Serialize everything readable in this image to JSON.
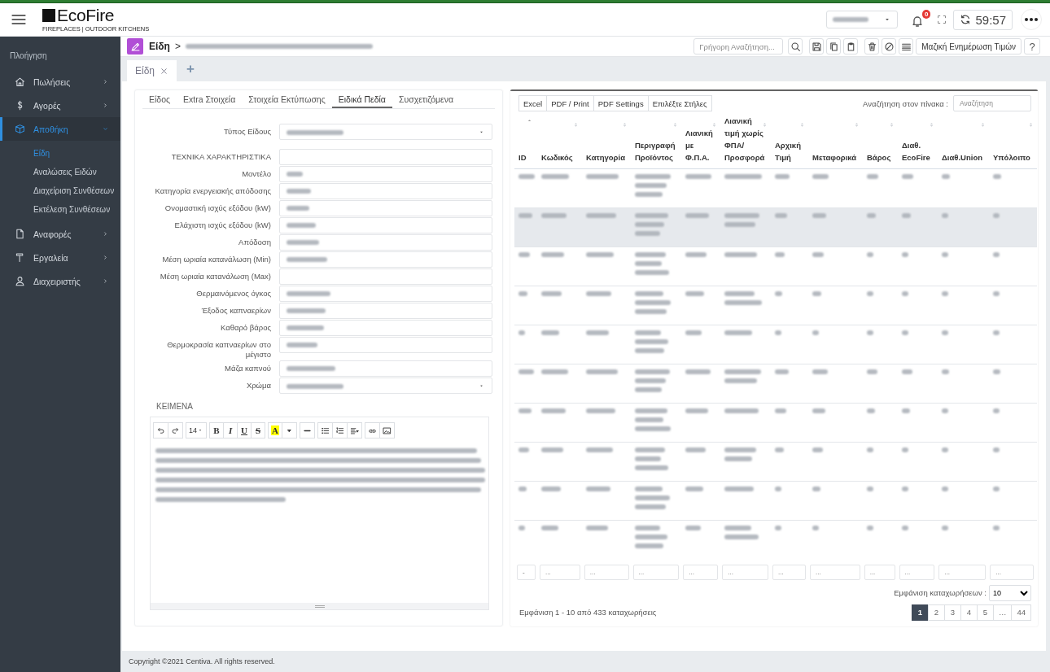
{
  "header": {
    "logo": {
      "name": "EcoFire",
      "tagline": "FIREPLACES | OUTDOOR KITCHENS"
    },
    "account_select": {
      "value_redacted": true
    },
    "notifications": {
      "count": "0"
    },
    "session_timer": "59:57"
  },
  "sidebar": {
    "heading": "Πλοήγηση",
    "items": [
      {
        "label": "Πωλήσεις",
        "selected": false,
        "expanded": false
      },
      {
        "label": "Αγορές",
        "selected": false,
        "expanded": false
      },
      {
        "label": "Αποθήκη",
        "selected": true,
        "expanded": true,
        "children": [
          {
            "label": "Είδη",
            "selected": true
          },
          {
            "label": "Αναλώσεις Ειδών",
            "selected": false
          },
          {
            "label": "Διαχείριση Συνθέσεων",
            "selected": false
          },
          {
            "label": "Εκτέλεση Συνθέσεων",
            "selected": false
          }
        ]
      },
      {
        "label": "Αναφορές",
        "selected": false,
        "expanded": false
      },
      {
        "label": "Εργαλεία",
        "selected": false,
        "expanded": false
      },
      {
        "label": "Διαχειριστής",
        "selected": false,
        "expanded": false
      }
    ]
  },
  "toolbar": {
    "breadcrumb": {
      "root": "Είδη",
      "separator": ">",
      "current_redacted": true
    },
    "quick_search": {
      "placeholder": "Γρήγορη Αναζήτηση..."
    },
    "mass_update": "Μαζική Ενημέρωση Τιμών",
    "help": "?"
  },
  "document_tabs": {
    "tabs": [
      {
        "label": "Είδη",
        "selected": true,
        "closable": true
      }
    ],
    "add": "+"
  },
  "form": {
    "tabs": [
      {
        "label": "Είδος",
        "selected": false
      },
      {
        "label": "Extra Στοιχεία",
        "selected": false
      },
      {
        "label": "Στοιχεία Εκτύπωσης",
        "selected": false
      },
      {
        "label": "Ειδικά Πεδία",
        "selected": true
      },
      {
        "label": "Συσχετιζόμενα",
        "selected": false
      }
    ],
    "fields": [
      {
        "label": "Τύπος Είδους",
        "kind": "select",
        "value_redacted": true
      },
      {
        "label": "ΤΕΧΝΙΚΑ ΧΑΡΑΚΤΗΡΙΣΤΙΚΑ",
        "kind": "text",
        "value_redacted": false
      },
      {
        "label": "Μοντέλο",
        "kind": "text",
        "value_redacted": true
      },
      {
        "label": "Κατηγορία ενεργειακής απόδοσης",
        "kind": "text",
        "value_redacted": true
      },
      {
        "label": "Ονομαστική ισχύς εξόδου (kW)",
        "kind": "text",
        "value_redacted": true
      },
      {
        "label": "Ελάχιστη ισχύς εξόδου (kW)",
        "kind": "text",
        "value_redacted": true
      },
      {
        "label": "Απόδοση",
        "kind": "text",
        "value_redacted": true
      },
      {
        "label": "Μέση ωριαία κατανάλωση (Min)",
        "kind": "text",
        "value_redacted": true
      },
      {
        "label": "Μέση ωριαία κατανάλωση (Max)",
        "kind": "text",
        "value_redacted": false
      },
      {
        "label": "Θερμαινόμενος όγκος",
        "kind": "text",
        "value_redacted": true
      },
      {
        "label": "Έξοδος καπναερίων",
        "kind": "text",
        "value_redacted": true
      },
      {
        "label": "Καθαρό βάρος",
        "kind": "text",
        "value_redacted": true
      },
      {
        "label": "Θερμοκρασία καπναερίων στο μέγιστο",
        "kind": "text",
        "value_redacted": true
      },
      {
        "label": "Μάζα καπνού",
        "kind": "text",
        "value_redacted": true
      },
      {
        "label": "Χρώμα",
        "kind": "select",
        "value_redacted": true
      }
    ],
    "section": "ΚΕΙΜΕΝΑ",
    "editor": {
      "toolbar": [
        [
          {
            "kind": "undo"
          },
          {
            "kind": "redo"
          }
        ],
        [
          {
            "kind": "font_size",
            "label": "14"
          }
        ],
        [
          {
            "kind": "bold",
            "label": "B"
          },
          {
            "kind": "italic",
            "label": "I"
          },
          {
            "kind": "underline",
            "label": "U"
          },
          {
            "kind": "strike",
            "label": "S"
          }
        ],
        [
          {
            "kind": "highlight",
            "label": "A"
          },
          {
            "kind": "color_menu"
          }
        ],
        [
          {
            "kind": "hr"
          }
        ],
        [
          {
            "kind": "ul"
          },
          {
            "kind": "ol"
          },
          {
            "kind": "align"
          }
        ],
        [
          {
            "kind": "link"
          },
          {
            "kind": "image"
          }
        ]
      ],
      "content_redacted": true
    }
  },
  "table": {
    "buttons": [
      "Excel",
      "PDF / Print",
      "PDF Settings",
      "Επιλέξτε Στήλες"
    ],
    "search_label": "Αναζήτηση στον πίνακα :",
    "search_placeholder": "Αναζήτηση",
    "columns": [
      {
        "label": "ID",
        "sorted": true
      },
      {
        "label": "Κωδικός",
        "sorted": false
      },
      {
        "label": "Κατηγορία",
        "sorted": false
      },
      {
        "label": "Περιγραφή Προϊόντος",
        "sorted": false
      },
      {
        "label": "Λιανική με Φ.Π.Α.",
        "sorted": false
      },
      {
        "label": "Λιανική τιμή χωρίς ΦΠΑ/ Προσφορά",
        "sorted": false
      },
      {
        "label": "Αρχική Τιμή",
        "sorted": false
      },
      {
        "label": "Μεταφορικά",
        "sorted": false
      },
      {
        "label": "Βάρος",
        "sorted": false
      },
      {
        "label": "Διαθ. EcoFire",
        "sorted": false
      },
      {
        "label": "Διαθ.Union",
        "sorted": false
      },
      {
        "label": "Υπόλοιπο",
        "sorted": false
      }
    ],
    "rows": [
      {
        "selected": false
      },
      {
        "selected": true
      },
      {
        "selected": false
      },
      {
        "selected": false
      },
      {
        "selected": false
      },
      {
        "selected": false
      },
      {
        "selected": false
      },
      {
        "selected": false
      },
      {
        "selected": false
      },
      {
        "selected": false
      }
    ],
    "filters": [
      {
        "placeholder": "-"
      },
      {
        "placeholder": "..."
      },
      {
        "placeholder": "..."
      },
      {
        "placeholder": "..."
      },
      {
        "placeholder": "..."
      },
      {
        "placeholder": "..."
      },
      {
        "placeholder": "..."
      },
      {
        "placeholder": "..."
      },
      {
        "placeholder": "..."
      },
      {
        "placeholder": "..."
      },
      {
        "placeholder": "..."
      },
      {
        "placeholder": "..."
      }
    ],
    "page_size_label": "Εμφάνιση καταχωρήσεων :",
    "page_size": "10",
    "info": "Εμφάνιση 1 - 10 από 433 καταχωρήσεις",
    "pages": [
      {
        "label": "1",
        "selected": true
      },
      {
        "label": "2",
        "selected": false
      },
      {
        "label": "3",
        "selected": false
      },
      {
        "label": "4",
        "selected": false
      },
      {
        "label": "5",
        "selected": false
      },
      {
        "label": "…",
        "selected": false
      },
      {
        "label": "44",
        "selected": false
      }
    ]
  },
  "footer": "Copyright ©2021 Centiva. All rights reserved."
}
